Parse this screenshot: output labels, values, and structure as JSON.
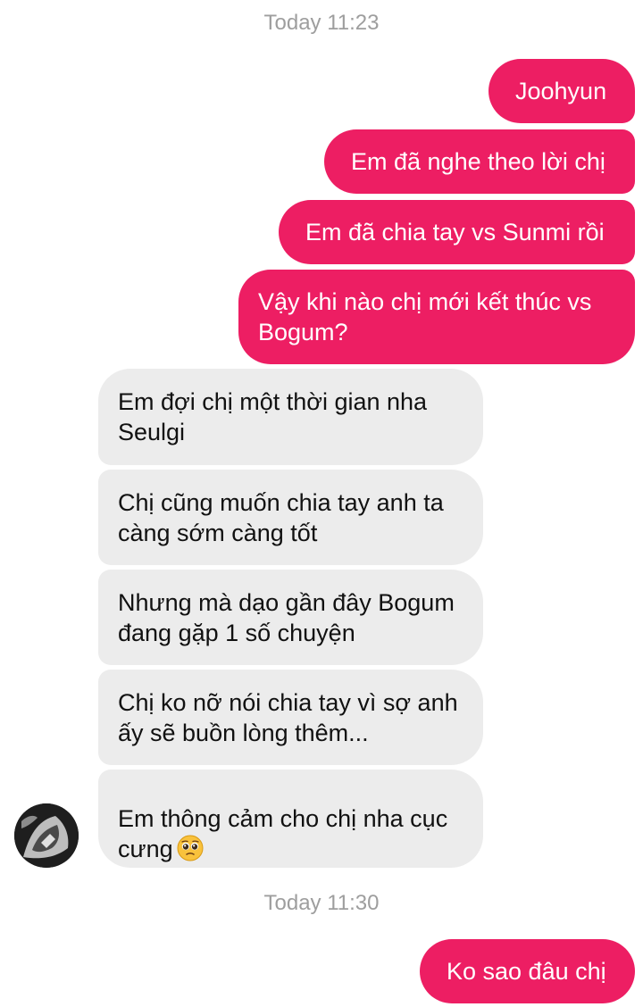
{
  "timestamps": {
    "first": "Today 11:23",
    "second": "Today 11:30"
  },
  "sent": [
    "Joohyun",
    "Em đã nghe theo lời chị",
    "Em đã chia tay vs Sunmi rồi",
    "Vậy khi nào chị mới kết thúc vs\nBogum?"
  ],
  "received": [
    "Em đợi chị một thời gian nha\nSeulgi",
    "Chị cũng muốn chia tay anh ta\ncàng sớm càng tốt",
    "Nhưng mà dạo gần đây Bogum\nđang gặp 1 số chuyện",
    "Chị ko nỡ nói chia tay vì sợ anh\nấy sẽ buồn lòng thêm...",
    "Em thông cảm cho chị nha cục\ncưng"
  ],
  "last_sent": "Ko sao đâu chị",
  "icons": {
    "avatar": "contact-avatar",
    "emoji": "pleading-face-emoji"
  },
  "colors": {
    "sent_bubble": "#ed1e63",
    "received_bubble": "#ececec",
    "timestamp": "#9e9e9e"
  }
}
